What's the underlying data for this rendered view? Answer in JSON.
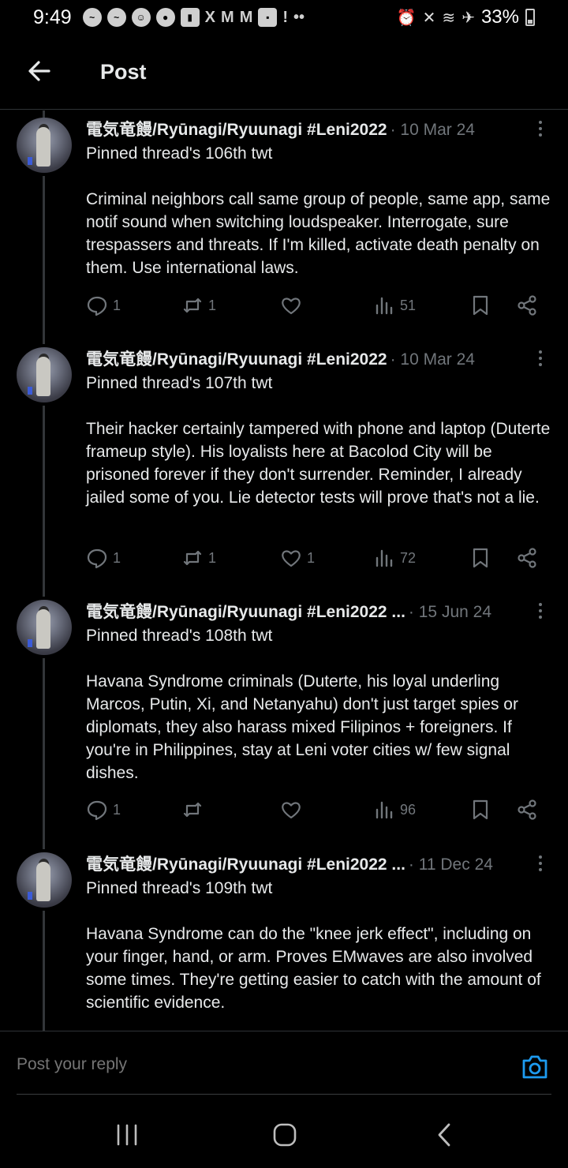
{
  "status_bar": {
    "time": "9:49",
    "battery": "33%",
    "apps": [
      "messenger-icon",
      "messenger-icon",
      "profile-icon",
      "reddit-icon",
      "twitch-icon",
      "x-icon",
      "gmail-icon",
      "gmail-icon",
      "chat-icon",
      "notification-icon"
    ],
    "more": "••"
  },
  "header": {
    "title": "Post"
  },
  "tweets": [
    {
      "name": "電気竜饅/Ryūnagi/Ryuunagi #Leni2022",
      "meta": "· 10 Mar 24",
      "body": "Pinned thread's 106th twt\n\nCriminal neighbors call same group of people, same app, same notif sound when switching loudspeaker. Interrogate, sure trespassers and threats. If I'm killed, activate death penalty on them. Use international laws.",
      "replies": "1",
      "reposts": "1",
      "likes": "",
      "views": "51"
    },
    {
      "name": "電気竜饅/Ryūnagi/Ryuunagi #Leni2022",
      "meta": "· 10 Mar 24",
      "body": "Pinned thread's 107th twt\n\nTheir hacker certainly tampered with phone and laptop (Duterte frameup style). His loyalists here at Bacolod City will be prisoned forever if they don't surrender. Reminder, I already jailed some of you. Lie detector tests will prove that's not a lie.",
      "replies": "1",
      "reposts": "1",
      "likes": "1",
      "views": "72"
    },
    {
      "name": "電気竜饅/Ryūnagi/Ryuunagi #Leni2022 ...",
      "meta": "· 15 Jun 24",
      "body": "Pinned thread's 108th twt\n\nHavana Syndrome criminals (Duterte, his loyal underling Marcos, Putin, Xi, and Netanyahu) don't just target spies or diplomats, they also harass mixed Filipinos + foreigners. If you're in Philippines, stay at Leni voter cities w/ few signal dishes.",
      "replies": "1",
      "reposts": "",
      "likes": "",
      "views": "96"
    },
    {
      "name": "電気竜饅/Ryūnagi/Ryuunagi #Leni2022 ...",
      "meta": "· 11 Dec 24",
      "body": "Pinned thread's 109th twt\n\nHavana Syndrome can do the \"knee jerk effect\", including on your finger, hand, or arm. Proves EMwaves are also involved some times. They're getting easier to catch with the amount of scientific evidence.",
      "replies": "",
      "reposts": "",
      "likes": "",
      "views": ""
    }
  ],
  "reply": {
    "placeholder": "Post your reply"
  },
  "colors": {
    "background": "#000000",
    "text": "#e7e9ea",
    "muted": "#71767b",
    "accent": "#1d9bf0",
    "divider": "#2f3336"
  }
}
